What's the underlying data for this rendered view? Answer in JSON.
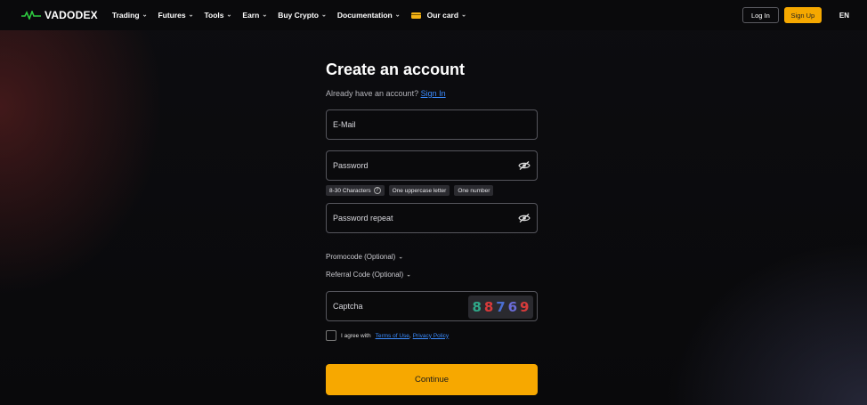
{
  "header": {
    "logo_text": "VADODEX",
    "nav": [
      {
        "label": "Trading"
      },
      {
        "label": "Futures"
      },
      {
        "label": "Tools"
      },
      {
        "label": "Earn"
      },
      {
        "label": "Buy Crypto"
      },
      {
        "label": "Documentation"
      },
      {
        "label": "Our card"
      }
    ],
    "login_label": "Log In",
    "signup_label": "Sign Up",
    "lang": "EN"
  },
  "form": {
    "title": "Create an account",
    "subtitle_text": "Already have an account?",
    "signin_link": "Sign In",
    "email_placeholder": "E-Mail",
    "password_placeholder": "Password",
    "password_hints": [
      "8-30 Characters",
      "One uppercase letter",
      "One number"
    ],
    "hint_help": "?",
    "password_repeat_placeholder": "Password repeat",
    "promocode_label": "Promocode (Optional)",
    "referral_label": "Referral Code (Optional)",
    "captcha_placeholder": "Captcha",
    "captcha_digits": [
      {
        "d": "8",
        "color": "#2fa889"
      },
      {
        "d": "8",
        "color": "#d93a3a"
      },
      {
        "d": "7",
        "color": "#4a6ed0"
      },
      {
        "d": "6",
        "color": "#6a6cd8"
      },
      {
        "d": "9",
        "color": "#d63b3b"
      }
    ],
    "agree_text": "I agree with",
    "terms_link": "Terms of Use",
    "comma": ",",
    "privacy_link": "Privacy Policy",
    "continue_label": "Continue"
  },
  "colors": {
    "accent": "#f7a800",
    "link": "#3b8cff",
    "logo_green": "#2ecc40"
  }
}
